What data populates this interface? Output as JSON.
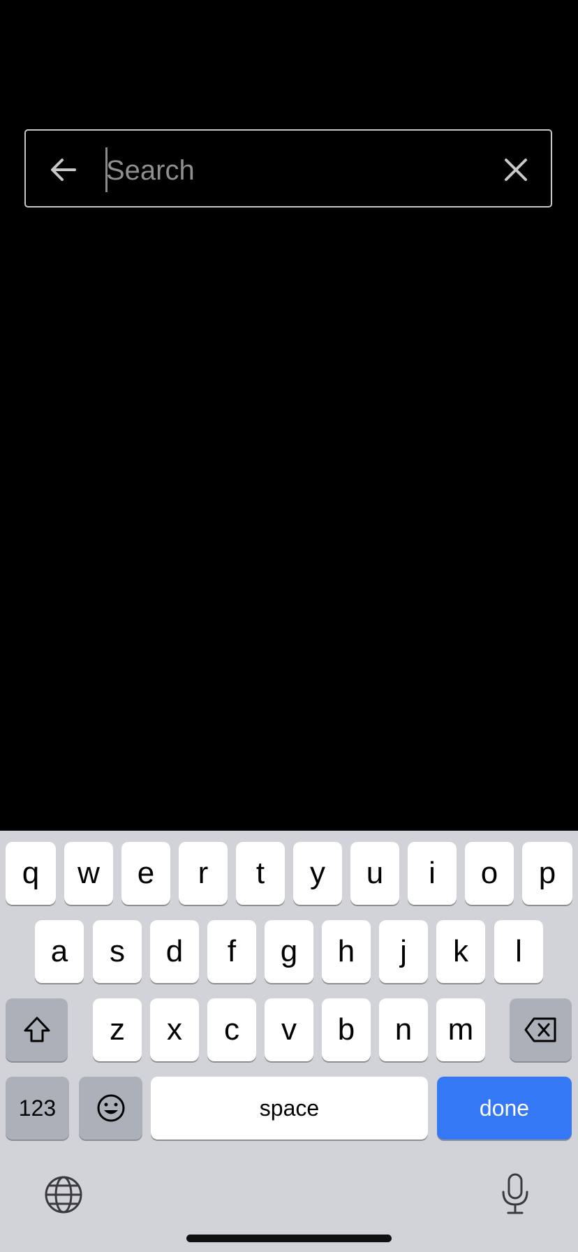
{
  "search": {
    "placeholder": "Search",
    "value": ""
  },
  "icons": {
    "back": "arrow-left-icon",
    "clear": "close-icon",
    "shift": "shift-icon",
    "backspace": "backspace-icon",
    "emoji": "emoji-icon",
    "globe": "globe-icon",
    "mic": "microphone-icon"
  },
  "keyboard": {
    "row1": [
      "q",
      "w",
      "e",
      "r",
      "t",
      "y",
      "u",
      "i",
      "o",
      "p"
    ],
    "row2": [
      "a",
      "s",
      "d",
      "f",
      "g",
      "h",
      "j",
      "k",
      "l"
    ],
    "row3": [
      "z",
      "x",
      "c",
      "v",
      "b",
      "n",
      "m"
    ],
    "numbers_label": "123",
    "space_label": "space",
    "done_label": "done"
  },
  "colors": {
    "accent": "#3478f6",
    "keyboard_bg": "#d1d3d9",
    "function_key": "#acb0b9"
  }
}
